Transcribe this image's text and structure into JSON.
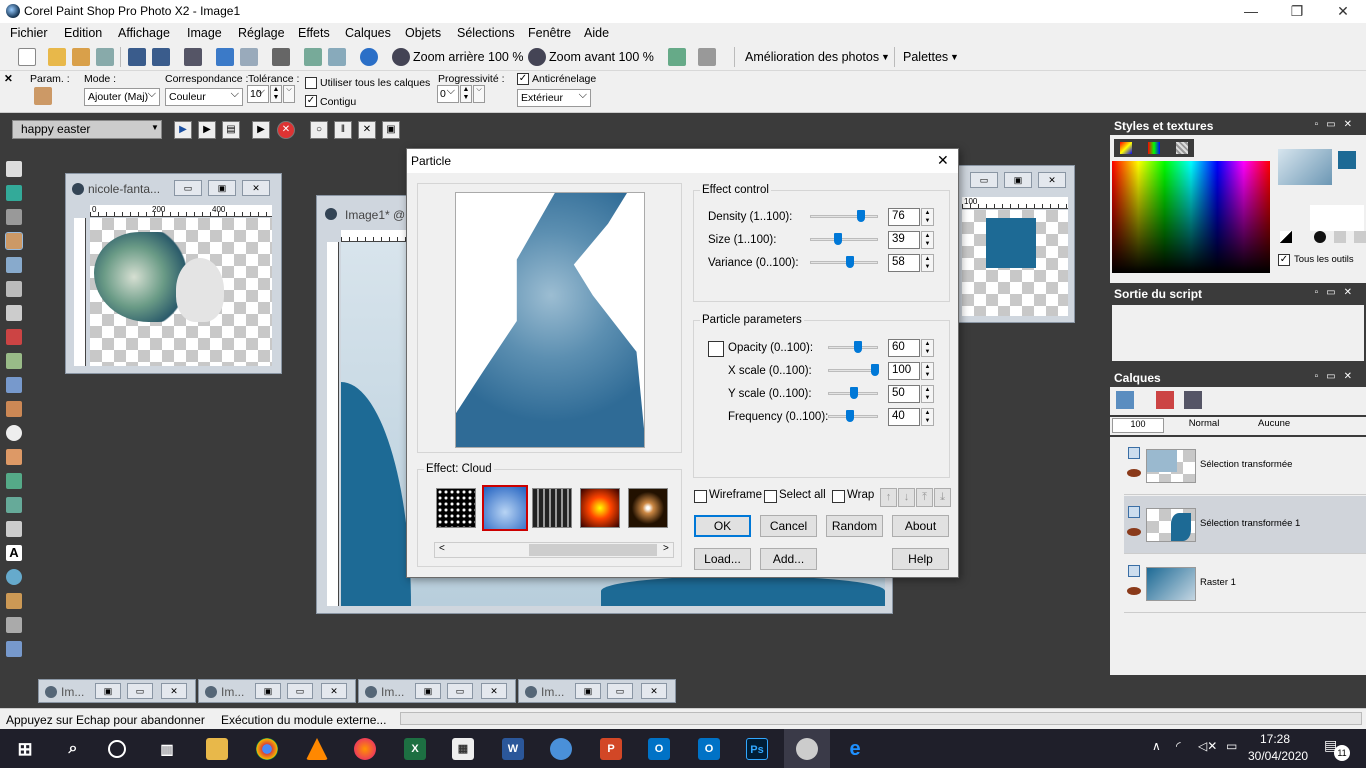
{
  "window": {
    "title": "Corel Paint Shop Pro Photo X2 - Image1",
    "minimize": "—",
    "restore": "❐",
    "close": "✕"
  },
  "menu": [
    "Fichier",
    "Edition",
    "Affichage",
    "Image",
    "Réglage",
    "Effets",
    "Calques",
    "Objets",
    "Sélections",
    "Fenêtre",
    "Aide"
  ],
  "toolbar": {
    "zoom_out": "Zoom arrière 100 %",
    "zoom_in": "Zoom avant 100 %",
    "photo_enhance": "Amélioration des photos",
    "palettes": "Palettes"
  },
  "options": {
    "presets_label": "Param. :",
    "mode_label": "Mode :",
    "mode_value": "Ajouter (Maj)",
    "match_label": "Correspondance :",
    "match_value": "Couleur",
    "tolerance_label": "Tolérance :",
    "tolerance_value": "10",
    "use_all_layers": "Utiliser tous les calques",
    "contiguous": "Contigu",
    "feather_label": "Progressivité :",
    "feather_value": "0",
    "antialias": "Anticrénelage",
    "antialias_mode": "Extérieur"
  },
  "script": {
    "name": "happy easter"
  },
  "documents": {
    "doc1_title": "nicole-fanta...",
    "doc2_title": "Image1* @",
    "doc1_ruler": [
      "0",
      "200",
      "400"
    ],
    "doc3_ruler": [
      "100"
    ],
    "minimized": [
      "Im...",
      "Im...",
      "Im...",
      "Im..."
    ]
  },
  "panels": {
    "styles_title": "Styles et textures",
    "all_tools": "Tous les outils",
    "script_output_title": "Sortie du script",
    "layers_title": "Calques",
    "opacity_value": "100",
    "blend_mode": "Normal",
    "mask_mode": "Aucune",
    "layers": [
      {
        "name": "Sélection transformée"
      },
      {
        "name": "Sélection transformée 1"
      },
      {
        "name": "Raster 1"
      }
    ]
  },
  "dialog": {
    "title": "Particle",
    "effect_control_label": "Effect control",
    "density_label": "Density (1..100):",
    "density": 76,
    "size_label": "Size (1..100):",
    "size": 39,
    "variance_label": "Variance (0..100):",
    "variance": 58,
    "particle_params_label": "Particle parameters",
    "opacity_label": "Opacity (0..100):",
    "opacity": 60,
    "xscale_label": "X scale (0..100):",
    "xscale": 100,
    "yscale_label": "Y scale (0..100):",
    "yscale": 50,
    "frequency_label": "Frequency (0..100):",
    "frequency": 40,
    "effect_label": "Effect: Cloud",
    "wireframe": "Wireframe",
    "select_all": "Select all",
    "wrap": "Wrap",
    "ok": "OK",
    "cancel": "Cancel",
    "random": "Random",
    "about": "About",
    "load": "Load...",
    "add": "Add...",
    "help": "Help"
  },
  "status": {
    "left": "Appuyez sur Echap pour abandonner",
    "right": "Exécution du module externe..."
  },
  "taskbar": {
    "time": "17:28",
    "date": "30/04/2020",
    "notifications": "11"
  },
  "colors": {
    "accent": "#0078d7",
    "doc_blue": "#1d6a95",
    "dark_bg": "#3b3b3b"
  }
}
